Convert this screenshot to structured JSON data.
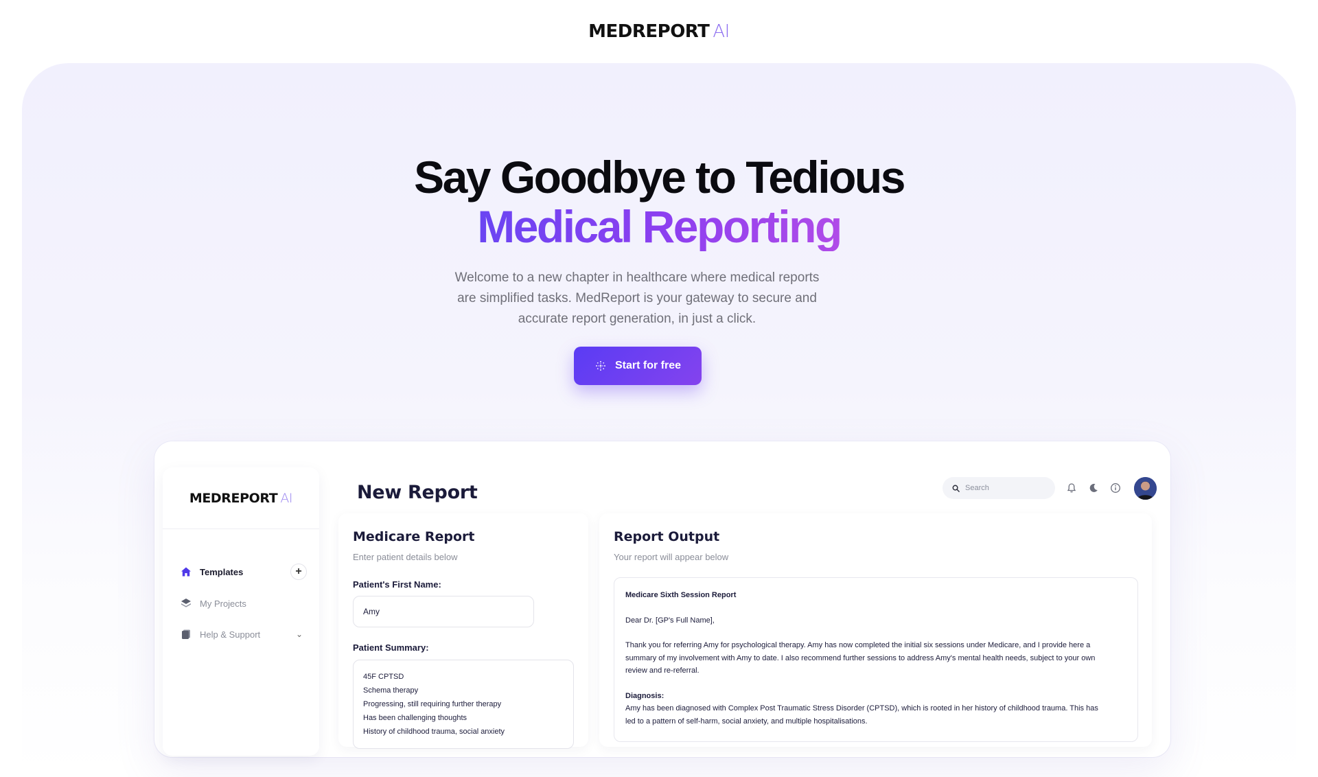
{
  "brand": {
    "name": "MEDREPORT",
    "suffix": "AI"
  },
  "hero": {
    "headline_line1": "Say Goodbye to Tedious",
    "headline_line2": "Medical Reporting",
    "lead": "Welcome to a new chapter in healthcare where medical reports are simplified tasks. MedReport is your gateway to secure and accurate report generation, in just a click.",
    "cta_label": "Start for free"
  },
  "app": {
    "sidebar": {
      "logo_name": "MEDREPORT",
      "logo_suffix": "AI",
      "items": [
        {
          "label": "Templates",
          "icon": "home-icon",
          "active": true
        },
        {
          "label": "My Projects",
          "icon": "layers-icon",
          "active": false
        },
        {
          "label": "Help & Support",
          "icon": "document-icon",
          "active": false
        }
      ]
    },
    "header": {
      "title": "New Report",
      "search_placeholder": "Search"
    },
    "form": {
      "title": "Medicare Report",
      "subtitle": "Enter patient details below",
      "first_name_label": "Patient's First Name:",
      "first_name_value": "Amy",
      "summary_label": "Patient Summary:",
      "summary_lines": [
        "45F CPTSD",
        "Schema therapy",
        "Progressing, still requiring further therapy",
        "Has been challenging thoughts",
        "History of childhood trauma, social anxiety"
      ]
    },
    "output": {
      "title": "Report Output",
      "subtitle": "Your report will appear below",
      "report_title": "Medicare Sixth Session Report",
      "salutation": "Dear Dr. [GP's Full Name],",
      "paragraph1": "Thank you for referring Amy for psychological therapy. Amy has now completed the initial six sessions under Medicare, and I provide here a summary of my involvement with Amy to date. I also recommend further sessions to address Amy's mental health needs, subject to your own review and re-referral.",
      "diagnosis_heading": "Diagnosis:",
      "diagnosis_text": "Amy has been diagnosed with Complex Post Traumatic Stress Disorder (CPTSD), which is rooted in her history of childhood trauma. This has led to a pattern of self-harm, social anxiety, and multiple hospitalisations."
    }
  },
  "colors": {
    "accent": "#6a45f2",
    "accent2": "#8443ee",
    "text_dark": "#1b1b3a",
    "muted": "#8a8d98"
  }
}
